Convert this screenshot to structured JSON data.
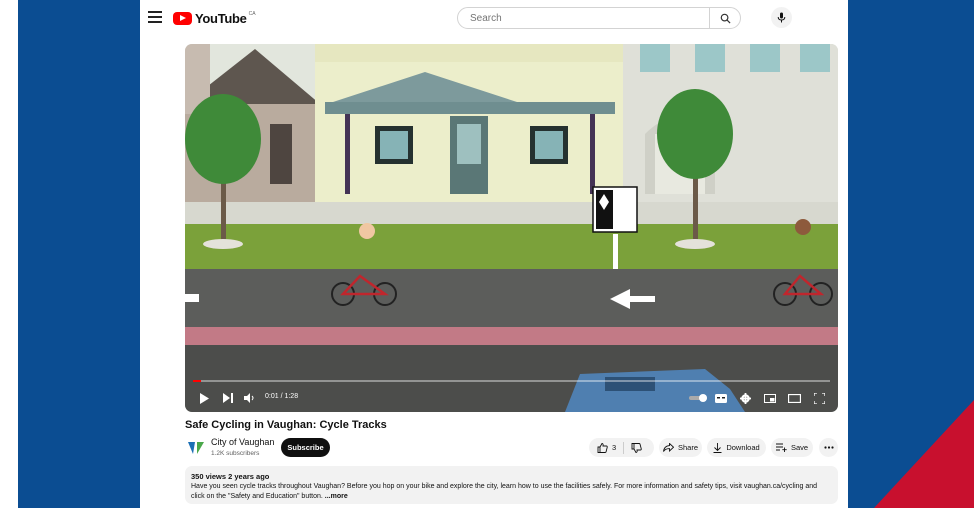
{
  "header": {
    "logo_text": "YouTube",
    "country_code": "CA",
    "search_placeholder": "Search"
  },
  "player": {
    "time": "0:01 / 1:28",
    "progress": 0.013
  },
  "video": {
    "title": "Safe Cycling in Vaughan: Cycle Tracks"
  },
  "channel": {
    "name": "City of Vaughan",
    "subscribers": "1.2K subscribers",
    "subscribe_label": "Subscribe"
  },
  "actions": {
    "likes": "3",
    "share": "Share",
    "download": "Download",
    "save": "Save"
  },
  "description": {
    "meta": "350 views  2 years ago",
    "text": "Have you seen cycle tracks throughout Vaughan? Before you hop on your bike and explore the city, learn how to use the facilities safely. For more information and safety tips, visit vaughan.ca/cycling and click on the \"Safety and Education\" button.",
    "more": "...more"
  },
  "colors": {
    "background_blue": "#0b4d92",
    "accent_red": "#c8102e",
    "youtube_red": "#ff0000"
  }
}
